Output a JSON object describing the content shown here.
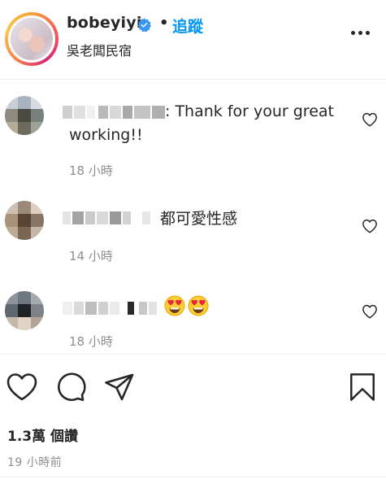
{
  "header": {
    "username": "bobeyiyi",
    "separator": "•",
    "follow_label": "追蹤",
    "location": "吳老闆民宿",
    "avatar_icon": "profile-avatar",
    "verified_icon": "verified-badge-icon",
    "more_icon": "more-options-icon"
  },
  "comments": [
    {
      "username_obscured": true,
      "text": ": Thank for your great",
      "text_line2": "working!!",
      "time": "18 小時"
    },
    {
      "username_obscured": true,
      "text": "都可愛性感",
      "time": "14 小時"
    },
    {
      "username_obscured": true,
      "emojis": [
        "heart-eyes-emoji",
        "heart-eyes-emoji"
      ],
      "time": "18 小時"
    }
  ],
  "actions": {
    "like_icon": "heart-icon",
    "comment_icon": "comment-icon",
    "share_icon": "send-icon",
    "save_icon": "bookmark-icon"
  },
  "stats": {
    "views": "1.3萬 個讚",
    "posted": "19 小時前"
  },
  "colors": {
    "accent": "#0095f6",
    "text": "#262626",
    "muted": "#8e8e8e",
    "verified": "#3897f0"
  }
}
